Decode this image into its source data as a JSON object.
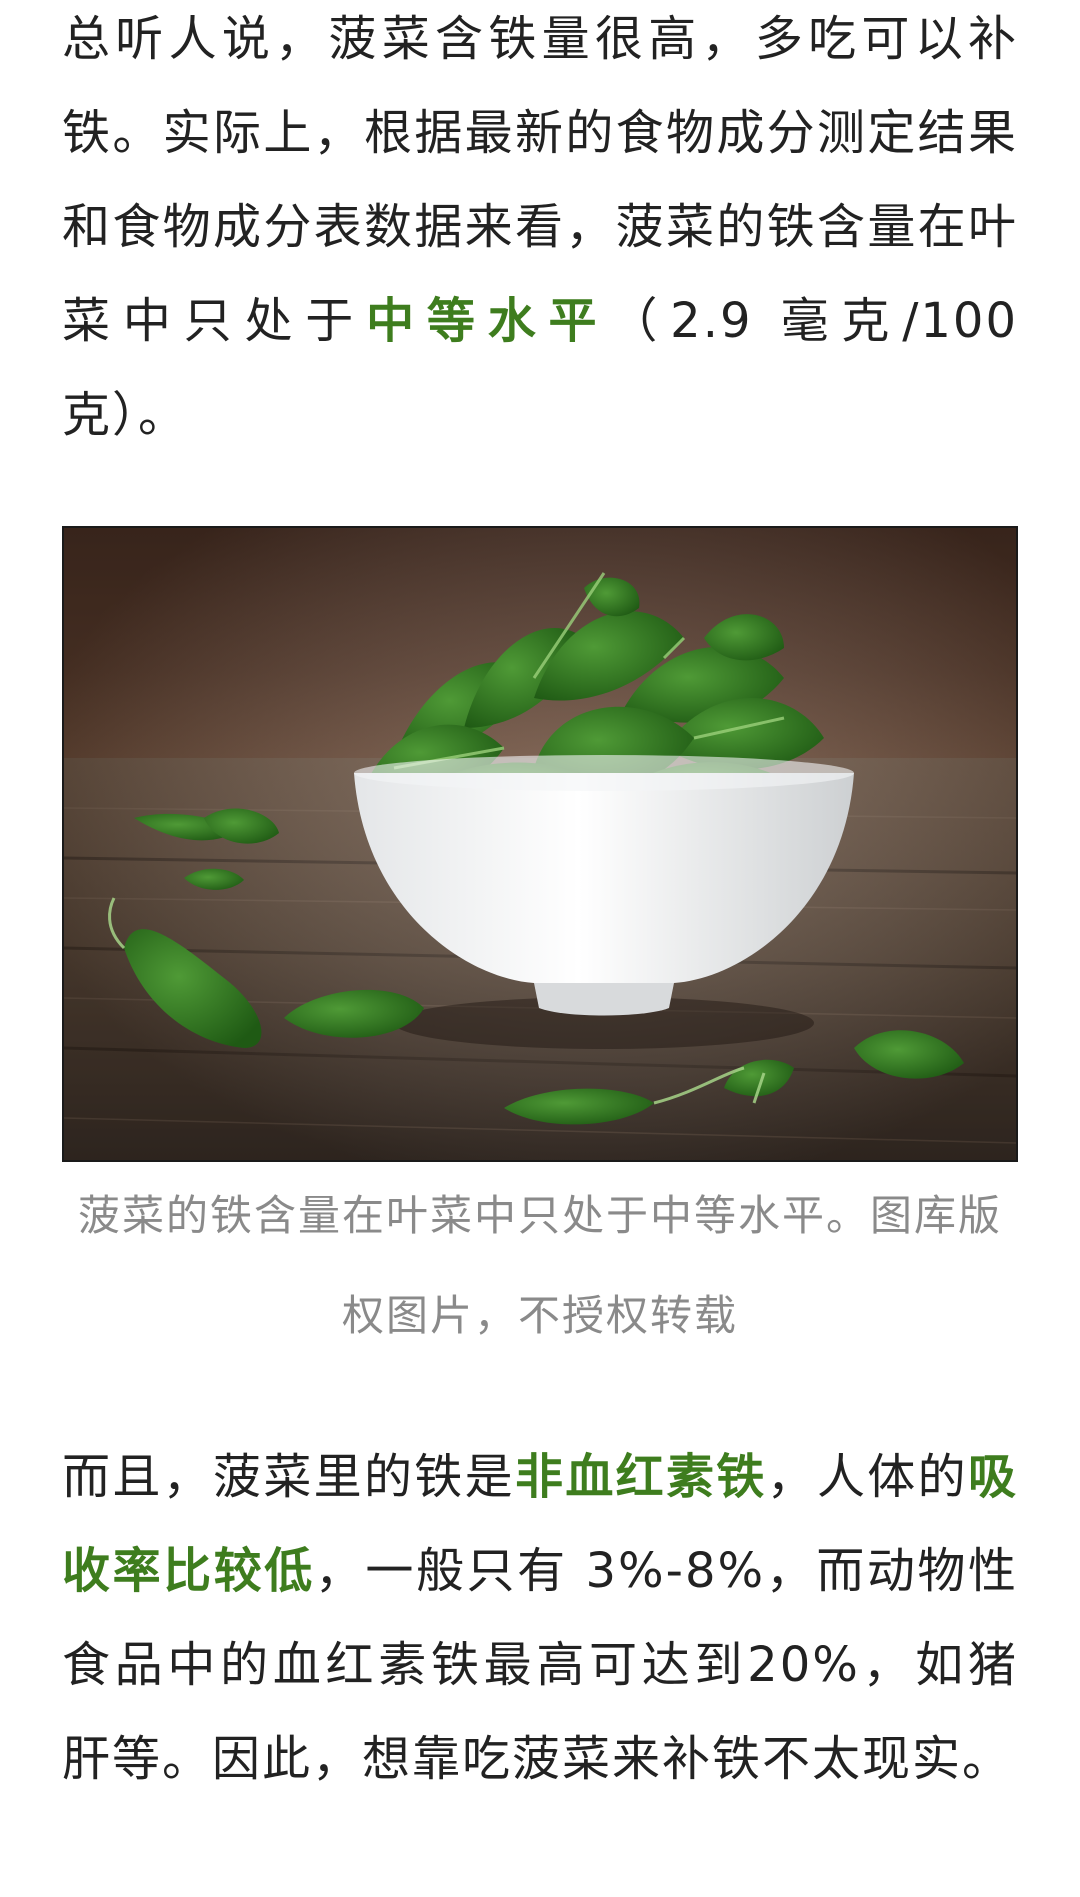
{
  "para1": {
    "text_a": "总听人说，菠菜含铁量很高，多吃可以补铁。实际上，根据最新的食物成分测定结果和食物成分表数据来看，菠菜的铁含量在叶菜中只处于",
    "highlight_a": "中等水平",
    "text_b": "（2.9 毫克/100 克）。"
  },
  "figure": {
    "image_subject": "spinach-bowl-photo",
    "caption": "菠菜的铁含量在叶菜中只处于中等水平。图库版权图片，不授权转载"
  },
  "para2": {
    "text_a": "而且，菠菜里的铁是",
    "highlight_a": "非血红素铁",
    "text_b": "，人体的",
    "highlight_b": "吸收率比较低",
    "text_c": "，一般只有 3%-8%，而动物性食品中的血红素铁最高可达到20%，如猪肝等。因此，想靠吃菠菜来补铁不太现实。"
  },
  "colors": {
    "highlight": "#3e7d1e",
    "body_text": "#222222",
    "caption_text": "#8a8a8a"
  }
}
